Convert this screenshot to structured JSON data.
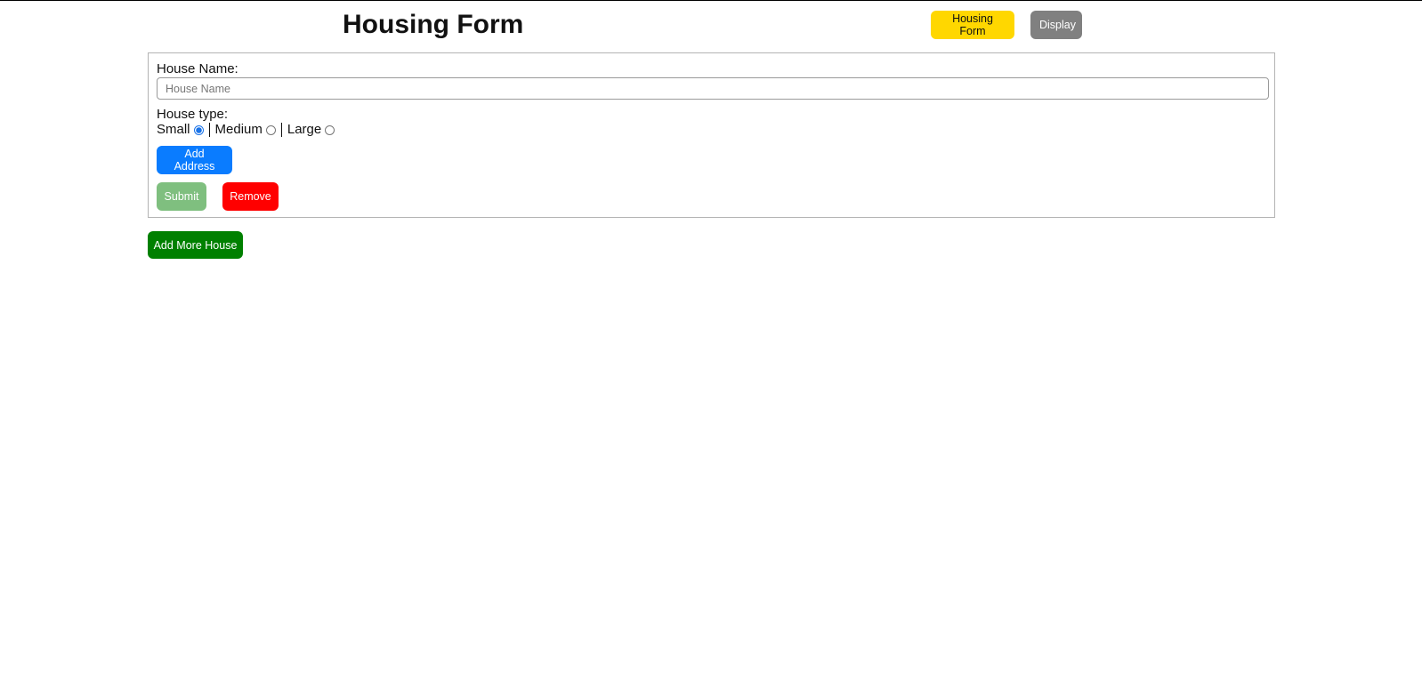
{
  "header": {
    "title": "Housing Form",
    "nav": {
      "housing_form_label": "Housing Form",
      "display_label": "Display"
    }
  },
  "form": {
    "house_name_label": "House Name:",
    "house_name_value": "",
    "house_name_placeholder": "House Name",
    "house_type_label": "House type:",
    "house_type_options": [
      {
        "label": "Small",
        "checked": true
      },
      {
        "label": "Medium",
        "checked": false
      },
      {
        "label": "Large",
        "checked": false
      }
    ],
    "add_address_label": "Add Address",
    "submit_label": "Submit",
    "remove_label": "Remove"
  },
  "add_more_label": "Add More House",
  "colors": {
    "nav_active_bg": "#ffd700",
    "nav_inactive_bg": "#808080",
    "add_address_bg": "#0a7cff",
    "submit_bg": "#7fbf7f",
    "remove_bg": "#ff0000",
    "add_more_bg": "#008000"
  }
}
